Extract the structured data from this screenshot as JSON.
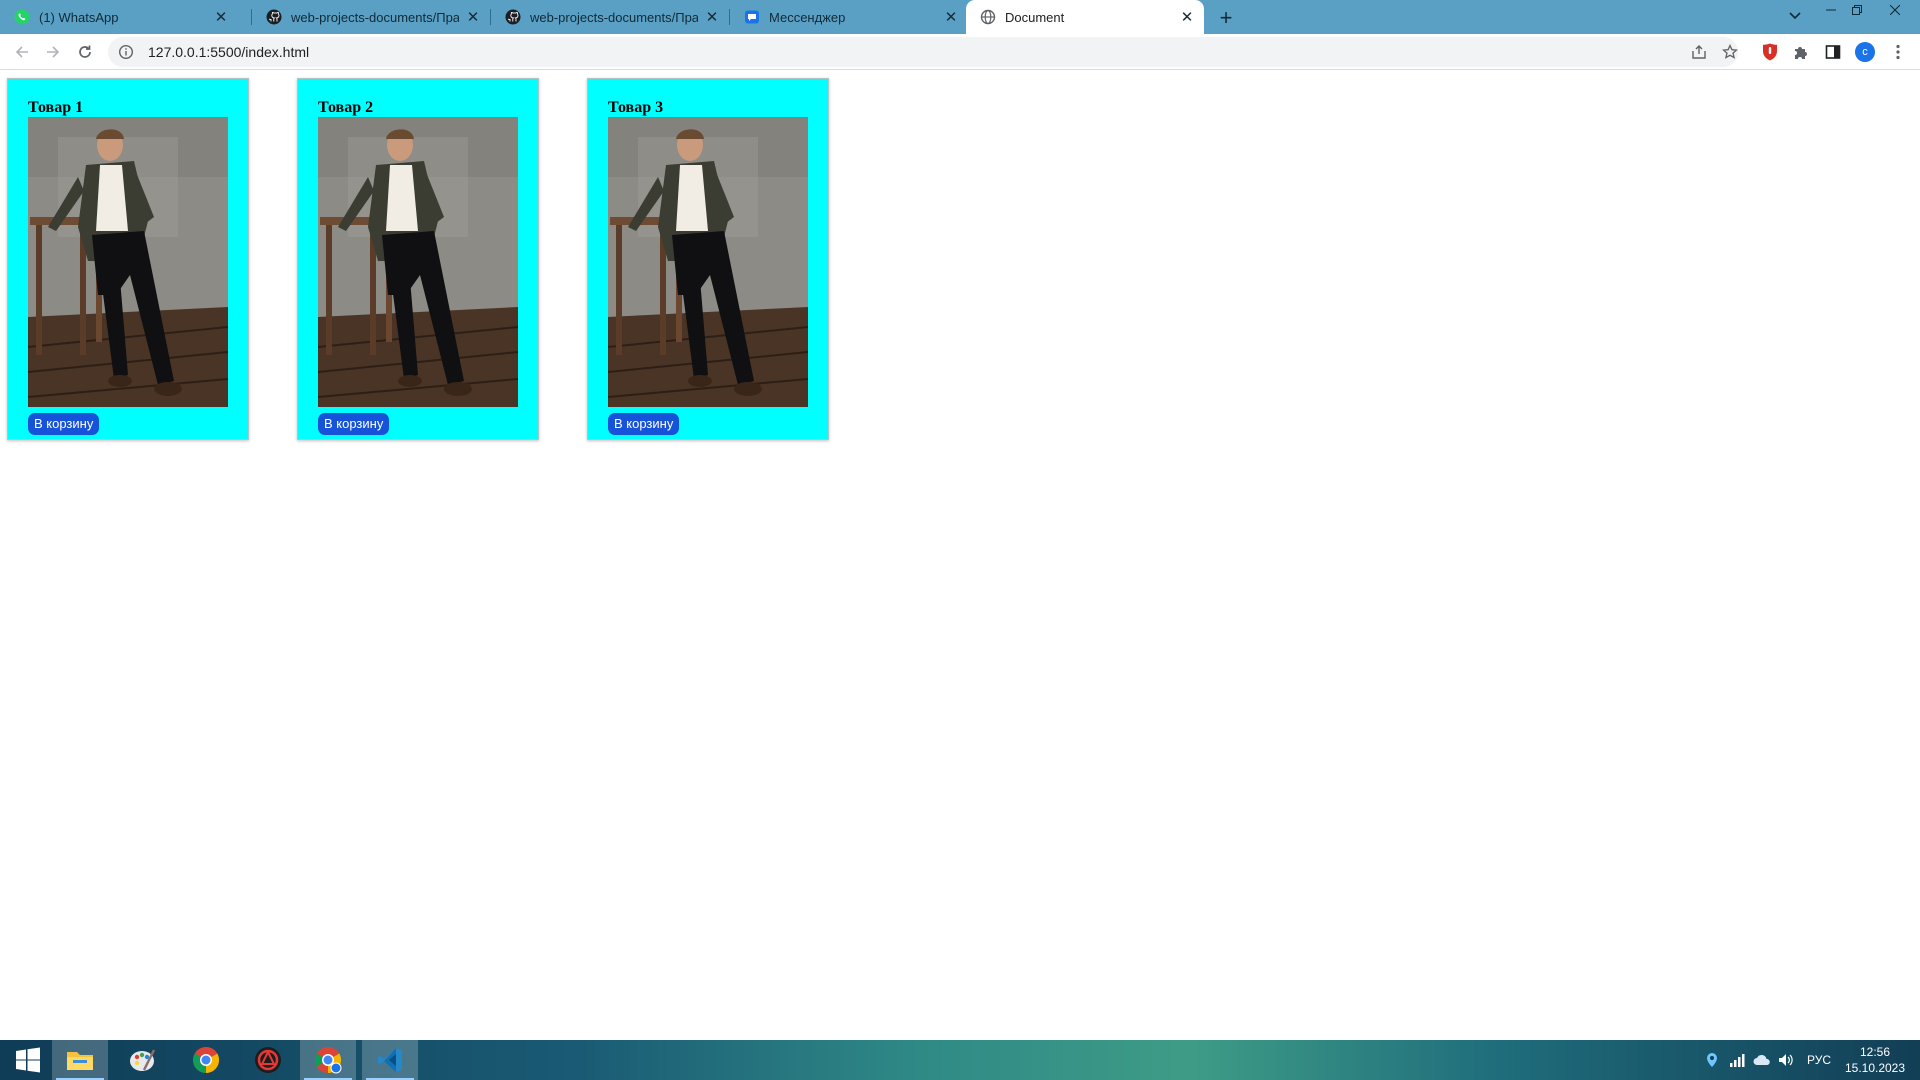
{
  "browser": {
    "tabs": [
      {
        "title": "(1) WhatsApp",
        "icon": "whatsapp-icon",
        "active": false
      },
      {
        "title": "web-projects-documents/Практи",
        "icon": "github-icon",
        "active": false
      },
      {
        "title": "web-projects-documents/Практи",
        "icon": "github-icon",
        "active": false
      },
      {
        "title": "Мессенджер",
        "icon": "messenger-icon",
        "active": false
      },
      {
        "title": "Document",
        "icon": "globe-icon",
        "active": true
      }
    ],
    "url": "127.0.0.1:5500/index.html",
    "profile_initial": "c"
  },
  "page": {
    "products": [
      {
        "title": "Товар 1",
        "button": "В корзину"
      },
      {
        "title": "Товар 2",
        "button": "В корзину"
      },
      {
        "title": "Товар 3",
        "button": "В корзину"
      }
    ],
    "card_background": "#00ffff",
    "button_color": "#1653d8"
  },
  "taskbar": {
    "apps": [
      "start-icon",
      "file-explorer-icon",
      "paint-icon",
      "chrome-icon",
      "antivirus-icon",
      "chrome-profile-icon",
      "vscode-icon"
    ],
    "language": "РУС",
    "time": "12:56",
    "date": "15.10.2023"
  }
}
